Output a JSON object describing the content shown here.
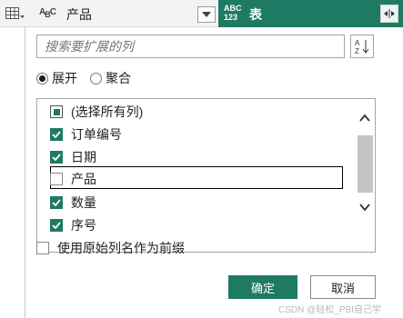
{
  "header": {
    "type_icon_main": "A",
    "type_icon_sub": "B",
    "type_icon_tail": "C",
    "column_name": "产品",
    "active_type_icon_top": "ABC",
    "active_type_icon_bottom": "123",
    "active_column_name": "表",
    "accent_color": "#1f7a63"
  },
  "search": {
    "placeholder": "搜索要扩展的列"
  },
  "mode": {
    "expand_label": "展开",
    "aggregate_label": "聚合",
    "selected": "expand"
  },
  "columns": {
    "items": [
      {
        "label": "(选择所有列)",
        "state": "partial"
      },
      {
        "label": "订单编号",
        "state": "checked"
      },
      {
        "label": "日期",
        "state": "checked"
      },
      {
        "label": "产品",
        "state": "unchecked"
      },
      {
        "label": "数量",
        "state": "checked"
      },
      {
        "label": "序号",
        "state": "checked"
      }
    ]
  },
  "prefix": {
    "label": "使用原始列名作为前缀",
    "checked": false
  },
  "buttons": {
    "ok": "确定",
    "cancel": "取消"
  },
  "watermark": "CSDN @轻松_PBI自己学"
}
